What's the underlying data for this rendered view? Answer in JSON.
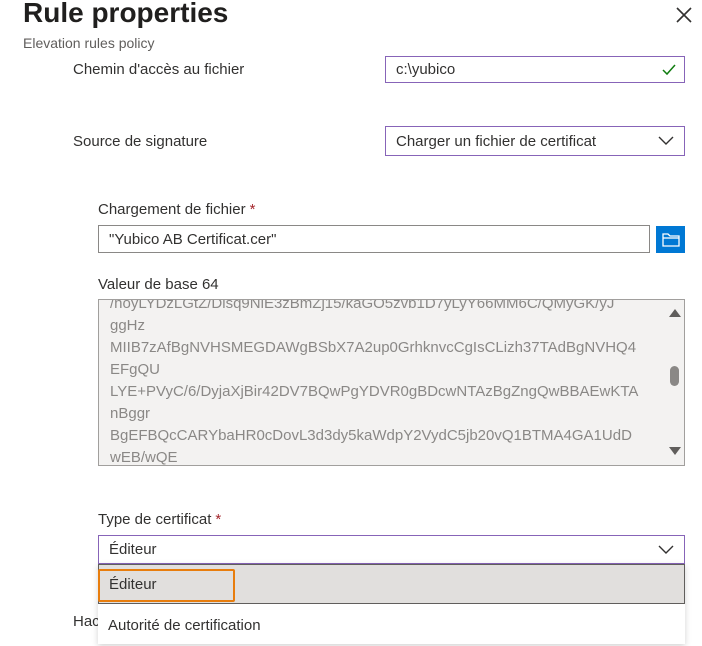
{
  "header": {
    "title": "Rule properties",
    "subtitle": "Elevation rules policy"
  },
  "form": {
    "file_path": {
      "label": "Chemin d'accès au fichier",
      "value": "c:\\yubico"
    },
    "signature_source": {
      "label": "Source de signature",
      "value": "Charger un fichier de certificat"
    },
    "file_upload": {
      "label": "Chargement de fichier",
      "required_marker": "*",
      "value": "\"Yubico AB Certificat.cer\""
    },
    "base64": {
      "label": "Valeur de base 64",
      "lines": [
        "/hoyLYDzLGtZ/Disq9NiE3zBmZj15/kaGO5zvb1D7yLyY66MM6C/QMyGK/yJ",
        "ggHz",
        "MIIB7zAfBgNVHSMEGDAWgBSbX7A2up0GrhknvcCgIsCLizh37TAdBgNVHQ4",
        "EFgQU",
        "LYE+PVyC/6/DyjaXjBir42DV7BQwPgYDVR0gBDcwNTAzBgZngQwBBAEwKTA",
        "nBggr",
        "BgEFBQcCARYbaHR0cDovL3d3dy5kaWdpY2VydC5jb20vQ1BTMA4GA1UdD",
        "wEB/wQE"
      ]
    },
    "cert_type": {
      "label": "Type de certificat",
      "required_marker": "*",
      "value": "Éditeur",
      "options": [
        "Éditeur",
        "Autorité de certification"
      ]
    },
    "hidden_label_partial": "Hac"
  },
  "colors": {
    "primary": "#0078d4",
    "required": "#a4262c",
    "valid": "#107c10",
    "highlight": "#e87d0d"
  }
}
